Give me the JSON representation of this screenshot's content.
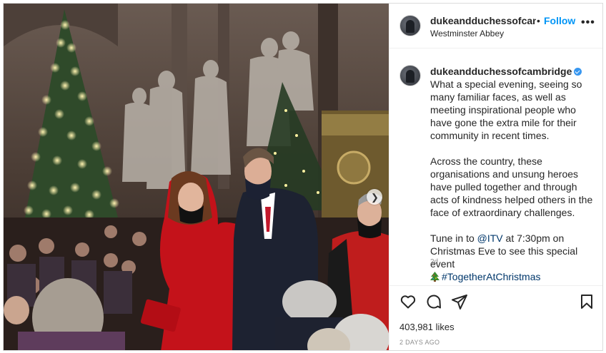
{
  "post": {
    "username_header": "dukeandduchessofcamb",
    "separator": "•",
    "follow_label": "Follow",
    "location": "Westminster Abbey",
    "more_label": "•••",
    "caption_username": "dukeandduchessofcambridge",
    "caption_text_1": "What a special evening, seeing so many familiar faces, as well as meeting inspirational people who have gone the extra mile for their community in recent times.",
    "caption_text_2": "Across the country, these organisations and unsung heroes have pulled together and through acts of kindness helped others in the face of extraordinary challenges.",
    "caption_text_3a": "Tune in to ",
    "caption_mention": "@ITV",
    "caption_text_3b": " at 7:30pm on Christmas Eve to see this special event ",
    "caption_hashtag": "#TogetherAtChristmas",
    "age": "2d",
    "likes": "403,981 likes",
    "time_ago": "2 DAYS AGO"
  },
  "icons": {
    "like": "heart-icon",
    "comment": "comment-icon",
    "share": "share-icon",
    "save": "bookmark-icon",
    "next": "chevron-right-icon",
    "tree": "christmas-tree-emoji",
    "verified": "verified-badge-icon"
  },
  "colors": {
    "link": "#00376b",
    "follow": "#0095f6",
    "verified": "#3897f0",
    "muted": "#8e8e8e"
  }
}
